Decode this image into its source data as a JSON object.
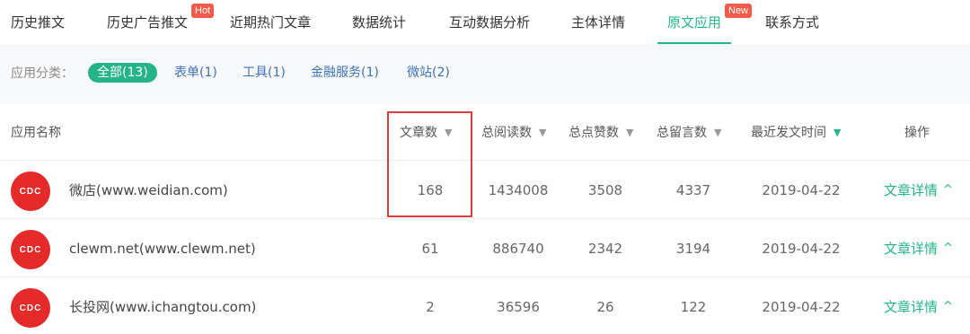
{
  "tabs": [
    {
      "label": "历史推文"
    },
    {
      "label": "历史广告推文",
      "badge": "Hot"
    },
    {
      "label": "近期热门文章"
    },
    {
      "label": "数据统计"
    },
    {
      "label": "互动数据分析"
    },
    {
      "label": "主体详情"
    },
    {
      "label": "原文应用",
      "badge": "New",
      "active": true
    },
    {
      "label": "联系方式"
    }
  ],
  "filter": {
    "label": "应用分类：",
    "chips": [
      "全部(13)",
      "表单(1)",
      "工具(1)",
      "金融服务(1)",
      "微站(2)"
    ]
  },
  "table": {
    "columns": [
      "应用名称",
      "文章数",
      "总阅读数",
      "总点赞数",
      "总留言数",
      "最近发文时间",
      "操作"
    ],
    "rows": [
      {
        "logo": "CDC",
        "name": "微店(www.weidian.com)",
        "articles": "168",
        "reads": "1434008",
        "likes": "3508",
        "comments": "4337",
        "last": "2019-04-22",
        "action": "文章详情"
      },
      {
        "logo": "CDC",
        "name": "clewm.net(www.clewm.net)",
        "articles": "61",
        "reads": "886740",
        "likes": "2342",
        "comments": "3194",
        "last": "2019-04-22",
        "action": "文章详情"
      },
      {
        "logo": "CDC",
        "name": "长投网(www.ichangtou.com)",
        "articles": "2",
        "reads": "36596",
        "likes": "26",
        "comments": "122",
        "last": "2019-04-22",
        "action": "文章详情"
      }
    ]
  },
  "icons": {
    "sort_arrow": "▼",
    "detail_caret": "^"
  },
  "colors": {
    "accent": "#25b48a",
    "link": "#3f73b8",
    "badge": "#f25a4a",
    "highlight": "#e03c3c",
    "logo": "#e52a2a"
  }
}
